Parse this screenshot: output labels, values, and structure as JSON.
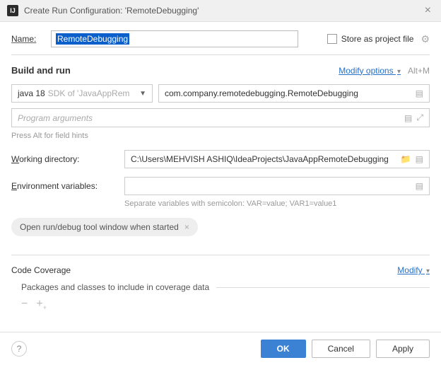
{
  "titlebar": {
    "title": "Create Run Configuration: 'RemoteDebugging'"
  },
  "name": {
    "label": "Name:",
    "value": "RemoteDebugging"
  },
  "store": {
    "label": "Store as project file"
  },
  "build_run": {
    "title": "Build and run",
    "modify": "Modify options",
    "shortcut": "Alt+M",
    "jdk_main": "java 18",
    "jdk_sdk": "SDK of 'JavaAppRem",
    "main_class": "com.company.remotedebugging.RemoteDebugging",
    "args_placeholder": "Program arguments",
    "hint": "Press Alt for field hints"
  },
  "working_dir": {
    "label_u": "W",
    "label_rest": "orking directory:",
    "value": "C:\\Users\\MEHVISH ASHIQ\\IdeaProjects\\JavaAppRemoteDebugging"
  },
  "env": {
    "label_u": "E",
    "label_rest": "nvironment variables:",
    "value": "",
    "helper": "Separate variables with semicolon: VAR=value; VAR1=value1"
  },
  "chip": {
    "label": "Open run/debug tool window when started"
  },
  "coverage": {
    "title": "Code Coverage",
    "modify": "Modify",
    "sub": "Packages and classes to include in coverage data"
  },
  "footer": {
    "ok": "OK",
    "cancel": "Cancel",
    "apply": "Apply"
  }
}
